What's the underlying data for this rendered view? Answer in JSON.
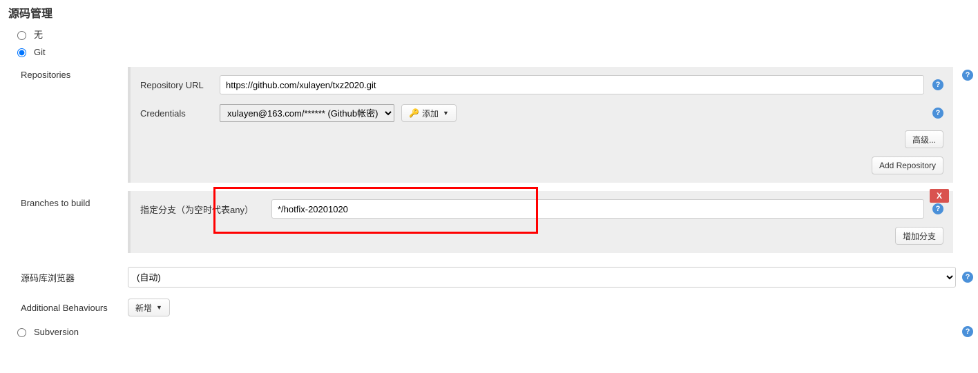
{
  "section": {
    "title": "源码管理"
  },
  "scm_options": {
    "none": "无",
    "git": "Git",
    "subversion": "Subversion"
  },
  "git": {
    "repositories": {
      "section_label": "Repositories",
      "url_label": "Repository URL",
      "url_value": "https://github.com/xulayen/txz2020.git",
      "credentials_label": "Credentials",
      "credentials_value": "xulayen@163.com/****** (Github帐密)",
      "add_button": "添加",
      "advanced_button": "高级...",
      "add_repo_button": "Add Repository"
    },
    "branches": {
      "section_label": "Branches to build",
      "branch_label": "指定分支（为空时代表any）",
      "branch_value": "*/hotfix-20201020",
      "delete_label": "X",
      "add_branch_button": "增加分支"
    },
    "browser": {
      "label": "源码库浏览器",
      "value": "(自动)"
    },
    "behaviours": {
      "label": "Additional Behaviours",
      "add_button": "新增"
    }
  }
}
